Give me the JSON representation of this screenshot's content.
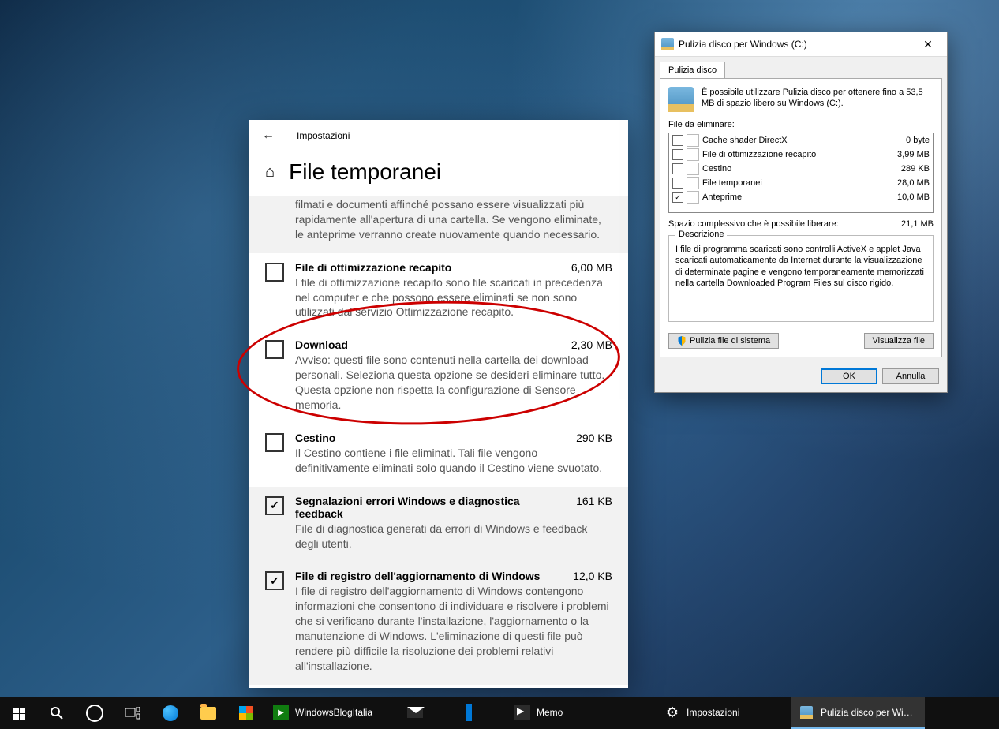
{
  "settings": {
    "header_label": "Impostazioni",
    "page_title": "File temporanei",
    "items": [
      {
        "title": "",
        "size": "",
        "desc": "filmati e documenti affinché possano essere visualizzati più rapidamente all'apertura di una cartella. Se vengono eliminate, le anteprime verranno create nuovamente quando necessario.",
        "checked": true,
        "partial": true
      },
      {
        "title": "File di ottimizzazione recapito",
        "size": "6,00 MB",
        "desc": "I file di ottimizzazione recapito sono file scaricati in precedenza nel computer e che possono essere eliminati se non sono utilizzati dal servizio Ottimizzazione recapito.",
        "checked": false
      },
      {
        "title": "Download",
        "size": "2,30 MB",
        "desc": "Avviso: questi file sono contenuti nella cartella dei download personali. Seleziona questa opzione se desideri eliminare tutto. Questa opzione non rispetta la configurazione di Sensore memoria.",
        "checked": false
      },
      {
        "title": "Cestino",
        "size": "290 KB",
        "desc": "Il Cestino contiene i file eliminati. Tali file vengono definitivamente eliminati solo quando il Cestino viene svuotato.",
        "checked": false
      },
      {
        "title": "Segnalazioni errori Windows e diagnostica feedback",
        "size": "161 KB",
        "desc": "File di diagnostica generati da errori di Windows e feedback degli utenti.",
        "checked": true
      },
      {
        "title": "File di registro dell'aggiornamento di Windows",
        "size": "12,0 KB",
        "desc": "I file di registro dell'aggiornamento di Windows contengono informazioni che consentono di individuare e risolvere i problemi che si verificano durante l'installazione, l'aggiornamento o la manutenzione di Windows. L'eliminazione di questi file può rendere più difficile la risoluzione dei problemi relativi all'installazione.",
        "checked": true
      }
    ]
  },
  "cleanup": {
    "window_title": "Pulizia disco per Windows (C:)",
    "tab_label": "Pulizia disco",
    "info_text": "È possibile utilizzare Pulizia disco per ottenere fino a 53,5 MB di spazio libero su Windows (C:).",
    "files_label": "File da eliminare:",
    "files": [
      {
        "name": "Cache shader DirectX",
        "size": "0 byte",
        "checked": false
      },
      {
        "name": "File di ottimizzazione recapito",
        "size": "3,99 MB",
        "checked": false
      },
      {
        "name": "Cestino",
        "size": "289 KB",
        "checked": false
      },
      {
        "name": "File temporanei",
        "size": "28,0 MB",
        "checked": false
      },
      {
        "name": "Anteprime",
        "size": "10,0 MB",
        "checked": true
      }
    ],
    "total_label": "Spazio complessivo che è possibile liberare:",
    "total_value": "21,1 MB",
    "desc_group_title": "Descrizione",
    "desc_text": "I file di programma scaricati sono controlli ActiveX e applet Java scaricati automaticamente da Internet durante la visualizzazione di determinate pagine e vengono temporaneamente memorizzati nella cartella Downloaded Program Files sul disco rigido.",
    "btn_system": "Pulizia file di sistema",
    "btn_view": "Visualizza file",
    "btn_ok": "OK",
    "btn_cancel": "Annulla"
  },
  "taskbar": {
    "tasks": [
      {
        "label": "WindowsBlogItalia",
        "icon": "green"
      },
      {
        "label": "",
        "icon": "mail"
      },
      {
        "label": "",
        "icon": "bluebar"
      },
      {
        "label": "Memo",
        "icon": "memo"
      },
      {
        "label": "",
        "icon": "spacer"
      },
      {
        "label": "Impostazioni",
        "icon": "gear",
        "active": false
      },
      {
        "label": "Pulizia disco per Wi…",
        "icon": "disk",
        "active": true
      }
    ]
  }
}
